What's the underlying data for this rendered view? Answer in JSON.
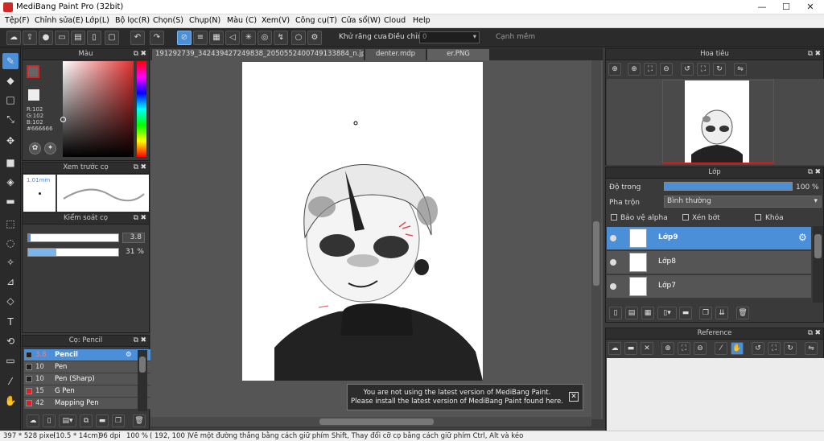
{
  "window": {
    "title": "MediBang Paint Pro (32bit)",
    "minimize": "—",
    "maximize": "☐",
    "close": "✕"
  },
  "menu": [
    "Tệp(F)",
    "Chỉnh sửa(E)",
    "Lớp(L)",
    "Bộ lọc(R)",
    "Chọn(S)",
    "Chụp(N)",
    "Màu (C)",
    "Xem(V)",
    "Công cụ(T)",
    "Cửa sổ(W)",
    "Cloud",
    "Help"
  ],
  "toolbar": {
    "antialias_label": "Khử răng cưa",
    "adjust_label": "Điều chỉnh",
    "adjust_value": "0",
    "snap_label": "Cạnh mềm"
  },
  "color_panel": {
    "title": "Màu",
    "r": "R:102",
    "g": "G:102",
    "b": "B:102",
    "hex": "#666666",
    "fg": "#666666"
  },
  "preview_panel": {
    "title": "Xem trước cọ",
    "size": "1.01mm"
  },
  "control_panel": {
    "title": "Kiểm soát cọ",
    "size_value": "3.8",
    "opacity_value": "31 %",
    "opacity_fraction": 0.31
  },
  "brush_panel": {
    "title": "Cọ: Pencil",
    "items": [
      {
        "size": "3.8",
        "name": "Pencil",
        "color": "#222222",
        "selected": true
      },
      {
        "size": "10",
        "name": "Pen",
        "color": "#222222"
      },
      {
        "size": "10",
        "name": "Pen (Sharp)",
        "color": "#222222"
      },
      {
        "size": "15",
        "name": "G Pen",
        "color": "#e02020"
      },
      {
        "size": "42",
        "name": "Mapping Pen",
        "color": "#e02020"
      }
    ]
  },
  "tabs": [
    "191292739_342439427249838_2050552400749133884_n.jpg",
    "denter.mdp",
    "er.PNG"
  ],
  "notice": {
    "line1": "You are not using the latest version of MediBang Paint.",
    "line2": "Please install the latest version of MediBang Paint found here."
  },
  "navigator": {
    "title": "Hoa tiêu"
  },
  "layer_panel": {
    "title": "Lớp",
    "opacity_label": "Độ trong",
    "opacity_value": "100 %",
    "opacity_fraction": 1.0,
    "blend_label": "Pha trộn",
    "blend_value": "Bình thường",
    "protect_alpha": "Bảo vệ alpha",
    "clipping": "Xén bớt",
    "lock": "Khóa",
    "layers": [
      {
        "name": "Lớp9",
        "selected": true
      },
      {
        "name": "Lớp8"
      },
      {
        "name": "Lớp7"
      }
    ]
  },
  "reference_panel": {
    "title": "Reference"
  },
  "status": {
    "size": "397 * 528 pixel",
    "physical": "(10.5 * 14cm)",
    "dpi": "96 dpi",
    "zoom": "100 %",
    "coords": "( 192, 100 )",
    "hint": "Vẽ một đường thẳng bằng cách giữ phím Shift, Thay đổi cỡ cọ bằng cách giữ phím Ctrl, Alt và kéo"
  }
}
